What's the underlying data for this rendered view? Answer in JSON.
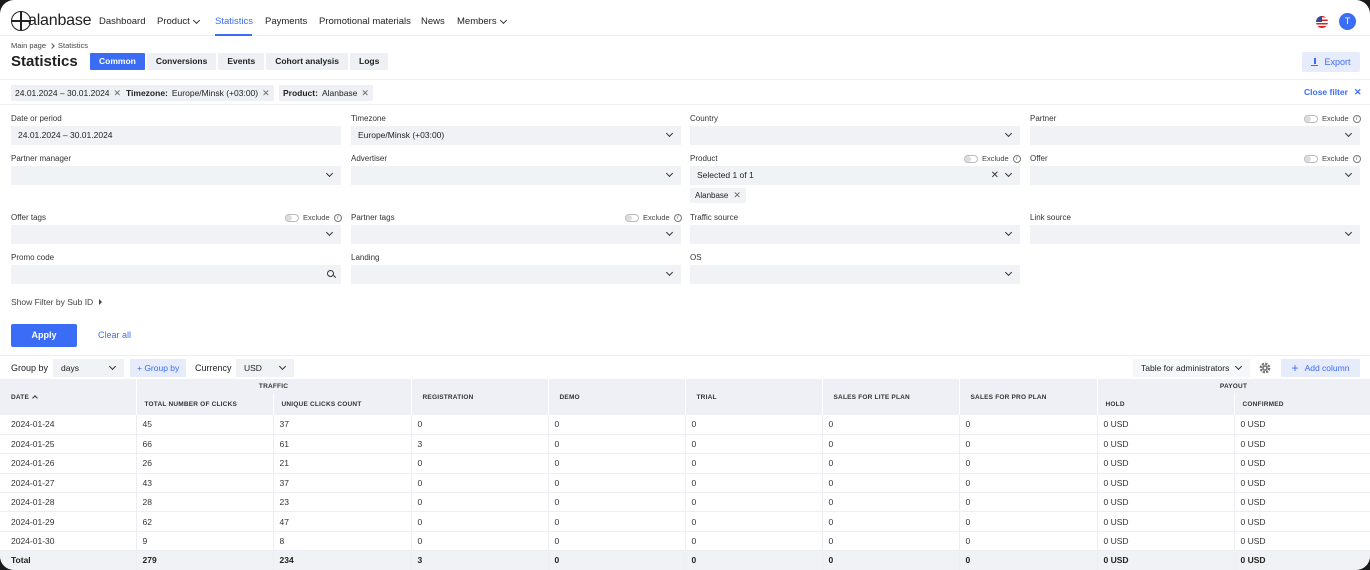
{
  "nav": {
    "logo": "alanbase",
    "items": [
      {
        "label": "Dashboard"
      },
      {
        "label": "Product"
      },
      {
        "label": "Statistics"
      },
      {
        "label": "Payments"
      },
      {
        "label": "Promotional materials"
      },
      {
        "label": "News"
      },
      {
        "label": "Members"
      }
    ],
    "avatar": "T"
  },
  "header": {
    "breadcrumb": [
      "Main page",
      "Statistics"
    ],
    "title": "Statistics",
    "tabs": [
      "Common",
      "Conversions",
      "Events",
      "Cohort analysis",
      "Logs"
    ],
    "export": "Export"
  },
  "chips": {
    "period": "24.01.2024 – 30.01.2024",
    "timezone_label": "Timezone:",
    "timezone_value": "Europe/Minsk (+03:00)",
    "product_label": "Product:",
    "product_value": "Alanbase",
    "close_filter": "Close filter"
  },
  "filters": {
    "date_label": "Date or period",
    "date_value": "24.01.2024 – 30.01.2024",
    "timezone_label": "Timezone",
    "timezone_value": "Europe/Minsk (+03:00)",
    "country_label": "Country",
    "partner_label": "Partner",
    "exclude": "Exclude",
    "partner_manager_label": "Partner manager",
    "advertiser_label": "Advertiser",
    "product_label": "Product",
    "product_value": "Selected 1 of 1",
    "product_tag": "Alanbase",
    "offer_label": "Offer",
    "offer_tags_label": "Offer tags",
    "partner_tags_label": "Partner tags",
    "traffic_source_label": "Traffic source",
    "link_source_label": "Link source",
    "promo_code_label": "Promo code",
    "landing_label": "Landing",
    "os_label": "OS",
    "show_subid": "Show Filter by Sub ID",
    "apply": "Apply",
    "clear_all": "Clear all"
  },
  "grouping": {
    "group_by_label": "Group by",
    "group_by_value": "days",
    "add_group": "+ Group by",
    "currency_label": "Currency",
    "currency_value": "USD",
    "table_preset": "Table for administrators",
    "add_column": "Add column"
  },
  "table": {
    "group_traffic": "TRAFFIC",
    "group_payout": "PAYOUT",
    "headers": {
      "date": "DATE",
      "total_clicks": "TOTAL NUMBER OF CLICKS",
      "unique_clicks": "UNIQUE CLICKS COUNT",
      "registration": "REGISTRATION",
      "demo": "DEMO",
      "trial": "TRIAL",
      "sales_lite": "SALES FOR LITE PLAN",
      "sales_pro": "SALES FOR PRO PLAN",
      "hold": "HOLD",
      "confirmed": "CONFIRMED"
    },
    "rows": [
      [
        "2024-01-24",
        "45",
        "37",
        "0",
        "0",
        "0",
        "0",
        "0",
        "0 USD",
        "0 USD"
      ],
      [
        "2024-01-25",
        "66",
        "61",
        "3",
        "0",
        "0",
        "0",
        "0",
        "0 USD",
        "0 USD"
      ],
      [
        "2024-01-26",
        "26",
        "21",
        "0",
        "0",
        "0",
        "0",
        "0",
        "0 USD",
        "0 USD"
      ],
      [
        "2024-01-27",
        "43",
        "37",
        "0",
        "0",
        "0",
        "0",
        "0",
        "0 USD",
        "0 USD"
      ],
      [
        "2024-01-28",
        "28",
        "23",
        "0",
        "0",
        "0",
        "0",
        "0",
        "0 USD",
        "0 USD"
      ],
      [
        "2024-01-29",
        "62",
        "47",
        "0",
        "0",
        "0",
        "0",
        "0",
        "0 USD",
        "0 USD"
      ],
      [
        "2024-01-30",
        "9",
        "8",
        "0",
        "0",
        "0",
        "0",
        "0",
        "0 USD",
        "0 USD"
      ]
    ],
    "total": [
      "Total",
      "279",
      "234",
      "3",
      "0",
      "0",
      "0",
      "0",
      "0 USD",
      "0 USD"
    ]
  }
}
